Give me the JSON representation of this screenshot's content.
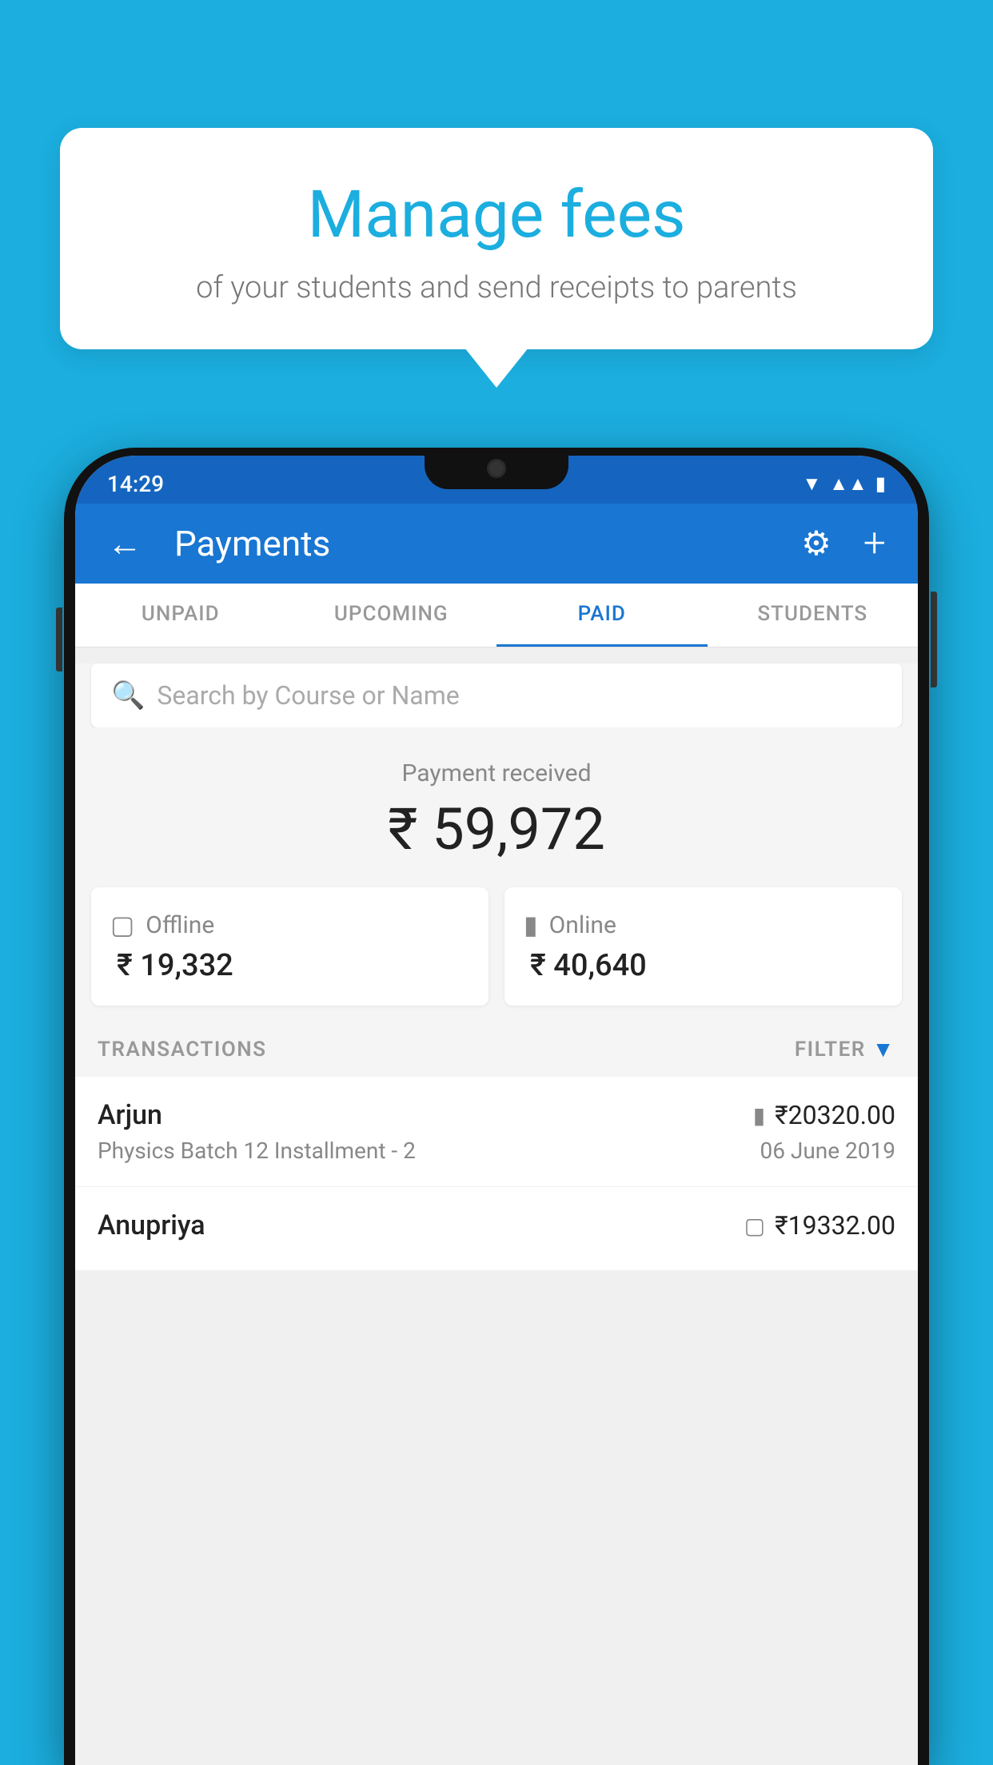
{
  "background": {
    "color": "#1BAEDF"
  },
  "speech_bubble": {
    "title": "Manage fees",
    "subtitle": "of your students and send receipts to parents"
  },
  "phone": {
    "status_bar": {
      "time": "14:29"
    },
    "header": {
      "title": "Payments",
      "back_label": "←",
      "gear_label": "⚙",
      "plus_label": "+"
    },
    "tabs": [
      {
        "label": "UNPAID",
        "active": false
      },
      {
        "label": "UPCOMING",
        "active": false
      },
      {
        "label": "PAID",
        "active": true
      },
      {
        "label": "STUDENTS",
        "active": false
      }
    ],
    "search": {
      "placeholder": "Search by Course or Name"
    },
    "payment_received": {
      "label": "Payment received",
      "amount": "₹ 59,972"
    },
    "payment_cards": [
      {
        "type": "Offline",
        "amount": "₹ 19,332",
        "icon": "offline"
      },
      {
        "type": "Online",
        "amount": "₹ 40,640",
        "icon": "online"
      }
    ],
    "transactions": {
      "header": "TRANSACTIONS",
      "filter_label": "FILTER",
      "rows": [
        {
          "name": "Arjun",
          "course": "Physics Batch 12 Installment - 2",
          "amount": "₹20320.00",
          "date": "06 June 2019",
          "payment_type": "online"
        },
        {
          "name": "Anupriya",
          "course": "",
          "amount": "₹19332.00",
          "date": "",
          "payment_type": "offline"
        }
      ]
    }
  }
}
